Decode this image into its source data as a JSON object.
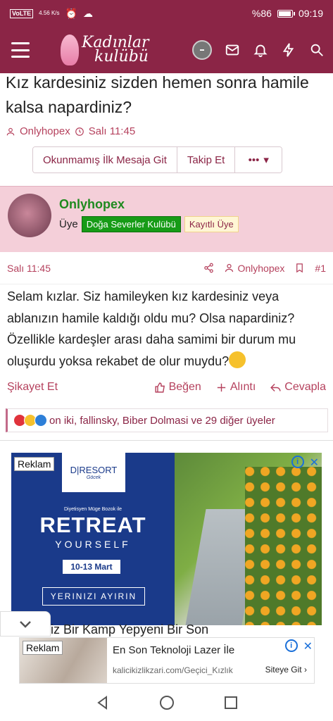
{
  "status_bar": {
    "network": "VoLTE",
    "speed": "4.56 K/s",
    "battery_text": "%86",
    "battery_level": 0.86,
    "time": "09:19"
  },
  "app_bar": {
    "logo_line1": "Kadınlar",
    "logo_line2": "kulübü",
    "icons": [
      "menu-icon",
      "avatar",
      "mail-icon",
      "bell-icon",
      "bolt-icon",
      "search-icon"
    ]
  },
  "thread": {
    "title": "Kız kardesiniz sizden hemen sonra hamile kalsa napardiniz?",
    "author": "Onlyhopex",
    "date": "Salı 11:45"
  },
  "buttons": {
    "unread": "Okunmamış İlk Mesaja Git",
    "follow": "Takip Et",
    "more": "•••"
  },
  "post": {
    "username": "Onlyhopex",
    "role_prefix": "Üye",
    "badge_group": "Doğa Severler Kulübü",
    "badge_status": "Kayıtlı Üye",
    "date": "Salı 11:45",
    "author": "Onlyhopex",
    "number": "#1",
    "body": "Selam kızlar. Siz hamileyken kız kardesiniz veya ablanızın hamile kaldığı oldu mu? Olsa napardiniz? Özellikle kardeşler arası daha samimi bir durum mu oluşurdu yoksa rekabet de olur muydu?",
    "report": "Şikayet Et",
    "like": "Beğen",
    "quote": "Alıntı",
    "reply": "Cevapla",
    "reactions_text": "on iki, fallinsky, Biber Dolmasi ve 29 diğer üyeler"
  },
  "ad1": {
    "label": "Reklam",
    "brand": "D|RESORT",
    "brand_sub": "Göcek",
    "subtitle": "Diyetisyen Müge Bozok ile",
    "headline": "RETREAT",
    "headline2": "YOURSELF",
    "dates": "10-13 Mart",
    "cta": "YERINIZI AYIRIN",
    "cut_text": "iz Bir Kamp Yepyeni Bir Son"
  },
  "ad2": {
    "label": "Reklam",
    "title": "En Son Teknoloji Lazer İle",
    "url": "kalicikizlikzari.com/Geçici_Kızlık",
    "go": "Siteye Git"
  },
  "colors": {
    "brand": "#8b2546",
    "accent": "#b5415d",
    "user_panel": "#f4cfd9",
    "username_green": "#1f8a1f"
  }
}
